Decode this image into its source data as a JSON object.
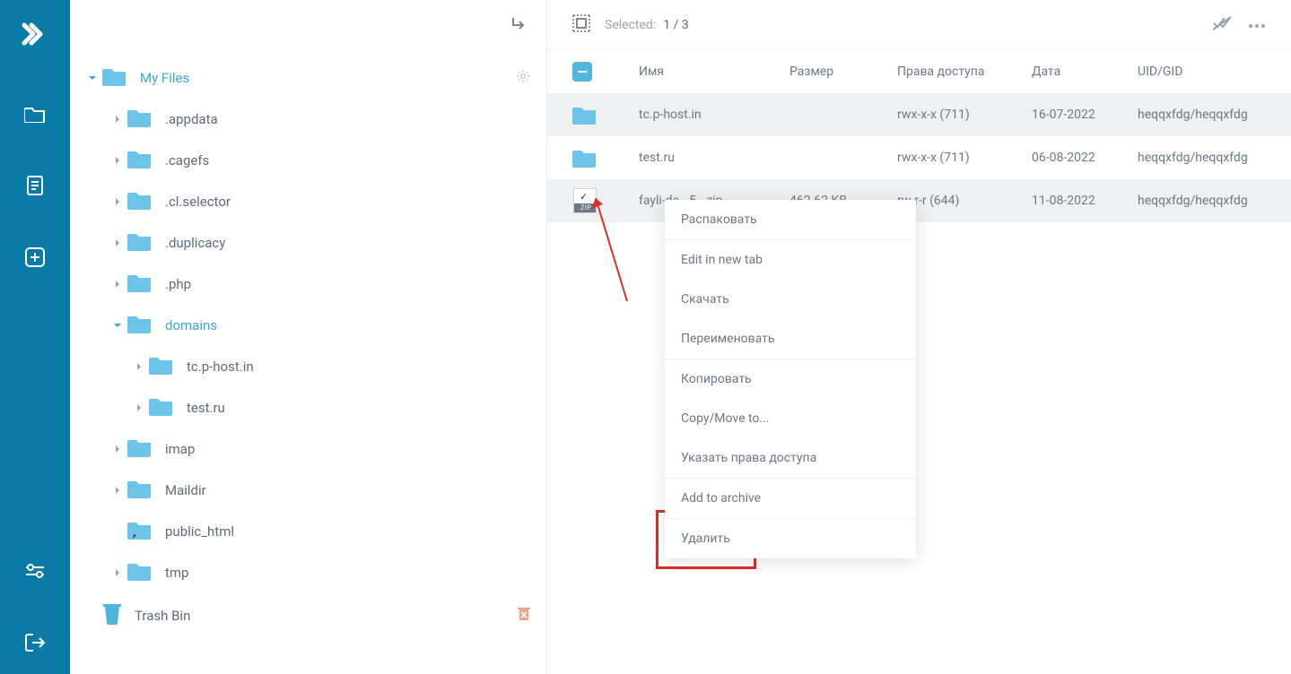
{
  "tree": {
    "root_label": "My Files",
    "trash_label": "Trash Bin",
    "folders": [
      {
        "name": ".appdata"
      },
      {
        "name": ".cagefs"
      },
      {
        "name": ".cl.selector"
      },
      {
        "name": ".duplicacy"
      },
      {
        "name": ".php"
      },
      {
        "name": "domains",
        "expanded": true,
        "children": [
          {
            "name": "tc.p-host.in"
          },
          {
            "name": "test.ru"
          }
        ]
      },
      {
        "name": "imap"
      },
      {
        "name": "Maildir"
      },
      {
        "name": "public_html",
        "leaf_arrow": true
      },
      {
        "name": "tmp"
      }
    ]
  },
  "toolbar": {
    "selected_label": "Selected:",
    "selected_count": "1 / 3"
  },
  "table": {
    "headers": {
      "name": "Имя",
      "size": "Размер",
      "perm": "Права доступа",
      "date": "Дата",
      "uid": "UID/GID"
    },
    "rows": [
      {
        "type": "folder",
        "name": "tc.p-host.in",
        "size": "",
        "perm": "rwx-x-x (711)",
        "date": "16-07-2022",
        "uid": "heqqxfdg/heqqxfdg",
        "selected": true
      },
      {
        "type": "folder",
        "name": "test.ru",
        "size": "",
        "perm": "rwx-x-x (711)",
        "date": "06-08-2022",
        "uid": "heqqxfdg/heqqxfdg",
        "selected": false
      },
      {
        "type": "zip",
        "name": "fayli-da...5...zip",
        "size": "462.62 KB",
        "perm": "rw-r-r (644)",
        "date": "11-08-2022",
        "uid": "heqqxfdg/heqqxfdg",
        "selected": true
      }
    ]
  },
  "context_menu": {
    "items": [
      {
        "label": "Распаковать"
      },
      {
        "label": "Edit in new tab",
        "sep_before": true
      },
      {
        "label": "Скачать"
      },
      {
        "label": "Переименовать"
      },
      {
        "label": "Копировать",
        "sep_before": true
      },
      {
        "label": "Copy/Move to..."
      },
      {
        "label": "Указать права доступа"
      },
      {
        "label": "Add to archive",
        "sep_before": true
      },
      {
        "label": "Удалить",
        "sep_before": true,
        "highlighted": true
      }
    ]
  },
  "zip_band": ".ZIP"
}
